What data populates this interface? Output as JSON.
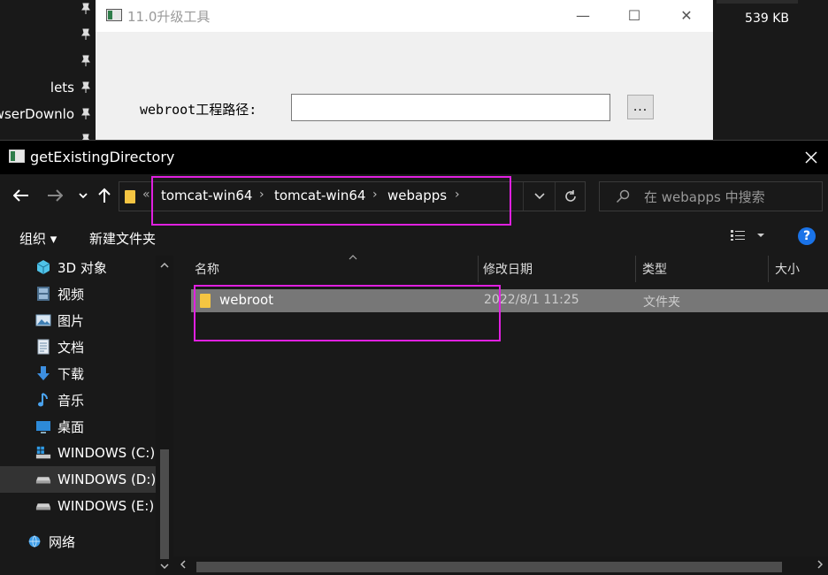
{
  "background": {
    "left_items": [
      {
        "label": ""
      },
      {
        "label": ""
      },
      {
        "label": ""
      },
      {
        "label": "lets"
      },
      {
        "label": "wserDownlo"
      },
      {
        "label": ""
      }
    ],
    "right_size": "539 KB"
  },
  "tool_window": {
    "title": "11.0升级工具",
    "label": "webroot工程路径:",
    "input_value": "",
    "browse_label": "...",
    "minimize": "—",
    "maximize": "☐",
    "close": "✕"
  },
  "dialog": {
    "title": "getExistingDirectory",
    "address": {
      "lead": "«",
      "crumbs": [
        "tomcat-win64",
        "tomcat-win64",
        "webapps"
      ]
    },
    "search_placeholder": "在 webapps 中搜索",
    "commands": {
      "organize": "组织 ▾",
      "new_folder": "新建文件夹"
    },
    "nav_items": [
      {
        "label": "3D 对象",
        "icon": "cube-icon"
      },
      {
        "label": "视频",
        "icon": "video-icon"
      },
      {
        "label": "图片",
        "icon": "picture-icon"
      },
      {
        "label": "文档",
        "icon": "document-icon"
      },
      {
        "label": "下载",
        "icon": "download-icon"
      },
      {
        "label": "音乐",
        "icon": "music-icon"
      },
      {
        "label": "桌面",
        "icon": "desktop-icon"
      },
      {
        "label": "WINDOWS (C:)",
        "icon": "drive-windows-icon"
      },
      {
        "label": "WINDOWS (D:)",
        "icon": "drive-icon",
        "selected": true
      },
      {
        "label": "WINDOWS (E:)",
        "icon": "drive-icon"
      },
      {
        "label": "网络",
        "icon": "network-icon"
      }
    ],
    "columns": {
      "name": "名称",
      "modified": "修改日期",
      "type": "类型",
      "size": "大小"
    },
    "files": [
      {
        "name": "webroot",
        "modified": "2022/8/1 11:25",
        "type": "文件夹",
        "size": ""
      }
    ]
  },
  "colors": {
    "highlight": "#e020e0",
    "accent": "#1a73e8",
    "folder": "#f5c542"
  }
}
